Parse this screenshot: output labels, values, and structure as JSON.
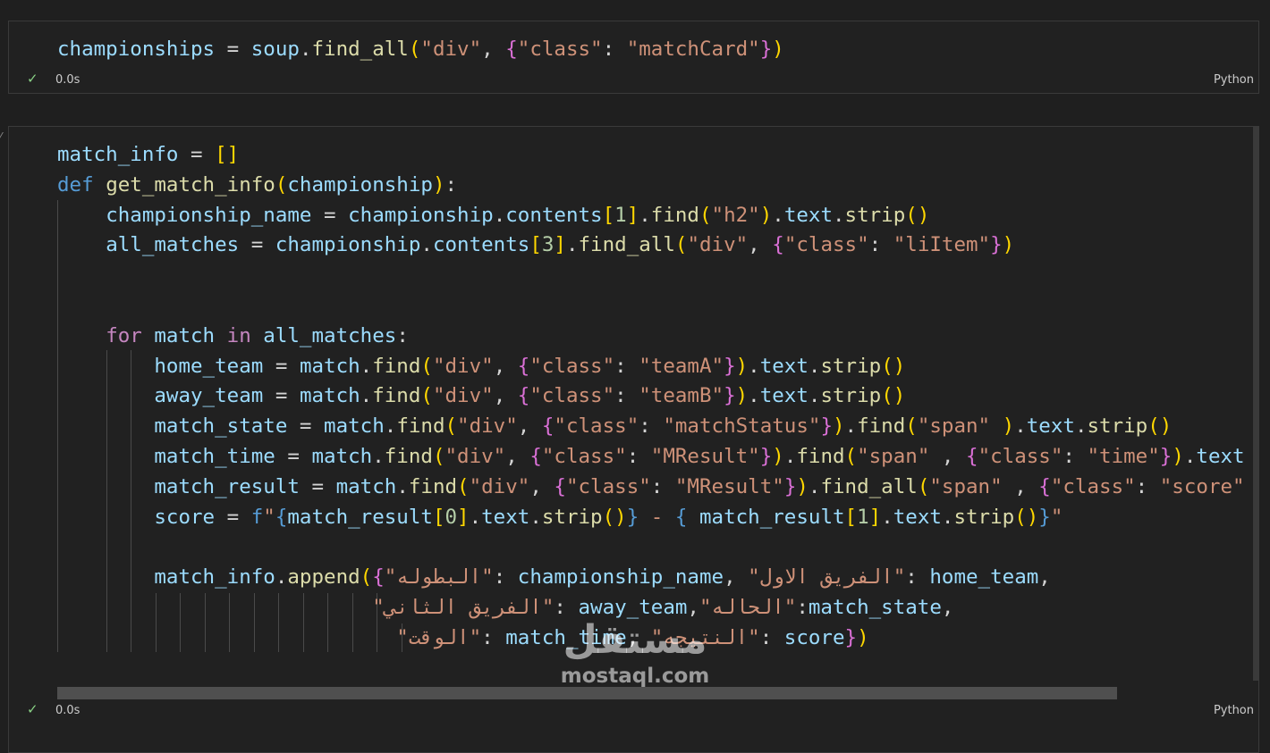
{
  "cell1": {
    "code": [
      [
        [
          "v",
          "championships"
        ],
        [
          "p",
          " = "
        ],
        [
          "v",
          "soup"
        ],
        [
          "p",
          "."
        ],
        [
          "f",
          "find_all"
        ],
        [
          "b1",
          "("
        ],
        [
          "s",
          "\"div\""
        ],
        [
          "p",
          ", "
        ],
        [
          "b2",
          "{"
        ],
        [
          "s",
          "\"class\""
        ],
        [
          "p",
          ": "
        ],
        [
          "s",
          "\"matchCard\""
        ],
        [
          "b2",
          "}"
        ],
        [
          "b1",
          ")"
        ]
      ]
    ],
    "status_check": "✓",
    "exec_time": "0.0s",
    "language": "Python"
  },
  "cell2": {
    "code": [
      [
        [
          "v",
          "match_info"
        ],
        [
          "p",
          " = "
        ],
        [
          "b1",
          "[]"
        ]
      ],
      [
        [
          "k",
          "def "
        ],
        [
          "f",
          "get_match_info"
        ],
        [
          "b1",
          "("
        ],
        [
          "v",
          "championship"
        ],
        [
          "b1",
          ")"
        ],
        [
          "p",
          ":"
        ]
      ],
      [
        [
          "p",
          "    "
        ],
        [
          "v",
          "championship_name"
        ],
        [
          "p",
          " = "
        ],
        [
          "v",
          "championship"
        ],
        [
          "p",
          "."
        ],
        [
          "v",
          "contents"
        ],
        [
          "b1",
          "["
        ],
        [
          "n",
          "1"
        ],
        [
          "b1",
          "]"
        ],
        [
          "p",
          "."
        ],
        [
          "f",
          "find"
        ],
        [
          "b1",
          "("
        ],
        [
          "s",
          "\"h2\""
        ],
        [
          "b1",
          ")"
        ],
        [
          "p",
          "."
        ],
        [
          "v",
          "text"
        ],
        [
          "p",
          "."
        ],
        [
          "f",
          "strip"
        ],
        [
          "b1",
          "()"
        ]
      ],
      [
        [
          "p",
          "    "
        ],
        [
          "v",
          "all_matches"
        ],
        [
          "p",
          " = "
        ],
        [
          "v",
          "championship"
        ],
        [
          "p",
          "."
        ],
        [
          "v",
          "contents"
        ],
        [
          "b1",
          "["
        ],
        [
          "n",
          "3"
        ],
        [
          "b1",
          "]"
        ],
        [
          "p",
          "."
        ],
        [
          "f",
          "find_all"
        ],
        [
          "b1",
          "("
        ],
        [
          "s",
          "\"div\""
        ],
        [
          "p",
          ", "
        ],
        [
          "b2",
          "{"
        ],
        [
          "s",
          "\"class\""
        ],
        [
          "p",
          ": "
        ],
        [
          "s",
          "\"liItem\""
        ],
        [
          "b2",
          "}"
        ],
        [
          "b1",
          ")"
        ]
      ],
      [],
      [],
      [
        [
          "p",
          "    "
        ],
        [
          "c",
          "for "
        ],
        [
          "v",
          "match"
        ],
        [
          "c",
          " in "
        ],
        [
          "v",
          "all_matches"
        ],
        [
          "p",
          ":"
        ]
      ],
      [
        [
          "p",
          "        "
        ],
        [
          "v",
          "home_team"
        ],
        [
          "p",
          " = "
        ],
        [
          "v",
          "match"
        ],
        [
          "p",
          "."
        ],
        [
          "f",
          "find"
        ],
        [
          "b1",
          "("
        ],
        [
          "s",
          "\"div\""
        ],
        [
          "p",
          ", "
        ],
        [
          "b2",
          "{"
        ],
        [
          "s",
          "\"class\""
        ],
        [
          "p",
          ": "
        ],
        [
          "s",
          "\"teamA\""
        ],
        [
          "b2",
          "}"
        ],
        [
          "b1",
          ")"
        ],
        [
          "p",
          "."
        ],
        [
          "v",
          "text"
        ],
        [
          "p",
          "."
        ],
        [
          "f",
          "strip"
        ],
        [
          "b1",
          "()"
        ]
      ],
      [
        [
          "p",
          "        "
        ],
        [
          "v",
          "away_team"
        ],
        [
          "p",
          " = "
        ],
        [
          "v",
          "match"
        ],
        [
          "p",
          "."
        ],
        [
          "f",
          "find"
        ],
        [
          "b1",
          "("
        ],
        [
          "s",
          "\"div\""
        ],
        [
          "p",
          ", "
        ],
        [
          "b2",
          "{"
        ],
        [
          "s",
          "\"class\""
        ],
        [
          "p",
          ": "
        ],
        [
          "s",
          "\"teamB\""
        ],
        [
          "b2",
          "}"
        ],
        [
          "b1",
          ")"
        ],
        [
          "p",
          "."
        ],
        [
          "v",
          "text"
        ],
        [
          "p",
          "."
        ],
        [
          "f",
          "strip"
        ],
        [
          "b1",
          "()"
        ]
      ],
      [
        [
          "p",
          "        "
        ],
        [
          "v",
          "match_state"
        ],
        [
          "p",
          " = "
        ],
        [
          "v",
          "match"
        ],
        [
          "p",
          "."
        ],
        [
          "f",
          "find"
        ],
        [
          "b1",
          "("
        ],
        [
          "s",
          "\"div\""
        ],
        [
          "p",
          ", "
        ],
        [
          "b2",
          "{"
        ],
        [
          "s",
          "\"class\""
        ],
        [
          "p",
          ": "
        ],
        [
          "s",
          "\"matchStatus\""
        ],
        [
          "b2",
          "}"
        ],
        [
          "b1",
          ")"
        ],
        [
          "p",
          "."
        ],
        [
          "f",
          "find"
        ],
        [
          "b1",
          "("
        ],
        [
          "s",
          "\"span\""
        ],
        [
          "p",
          " "
        ],
        [
          "b1",
          ")"
        ],
        [
          "p",
          "."
        ],
        [
          "v",
          "text"
        ],
        [
          "p",
          "."
        ],
        [
          "f",
          "strip"
        ],
        [
          "b1",
          "()"
        ]
      ],
      [
        [
          "p",
          "        "
        ],
        [
          "v",
          "match_time"
        ],
        [
          "p",
          " = "
        ],
        [
          "v",
          "match"
        ],
        [
          "p",
          "."
        ],
        [
          "f",
          "find"
        ],
        [
          "b1",
          "("
        ],
        [
          "s",
          "\"div\""
        ],
        [
          "p",
          ", "
        ],
        [
          "b2",
          "{"
        ],
        [
          "s",
          "\"class\""
        ],
        [
          "p",
          ": "
        ],
        [
          "s",
          "\"MResult\""
        ],
        [
          "b2",
          "}"
        ],
        [
          "b1",
          ")"
        ],
        [
          "p",
          "."
        ],
        [
          "f",
          "find"
        ],
        [
          "b1",
          "("
        ],
        [
          "s",
          "\"span\""
        ],
        [
          "p",
          " , "
        ],
        [
          "b2",
          "{"
        ],
        [
          "s",
          "\"class\""
        ],
        [
          "p",
          ": "
        ],
        [
          "s",
          "\"time\""
        ],
        [
          "b2",
          "}"
        ],
        [
          "b1",
          ")"
        ],
        [
          "p",
          "."
        ],
        [
          "v",
          "text"
        ]
      ],
      [
        [
          "p",
          "        "
        ],
        [
          "v",
          "match_result"
        ],
        [
          "p",
          " = "
        ],
        [
          "v",
          "match"
        ],
        [
          "p",
          "."
        ],
        [
          "f",
          "find"
        ],
        [
          "b1",
          "("
        ],
        [
          "s",
          "\"div\""
        ],
        [
          "p",
          ", "
        ],
        [
          "b2",
          "{"
        ],
        [
          "s",
          "\"class\""
        ],
        [
          "p",
          ": "
        ],
        [
          "s",
          "\"MResult\""
        ],
        [
          "b2",
          "}"
        ],
        [
          "b1",
          ")"
        ],
        [
          "p",
          "."
        ],
        [
          "f",
          "find_all"
        ],
        [
          "b1",
          "("
        ],
        [
          "s",
          "\"span\""
        ],
        [
          "p",
          " , "
        ],
        [
          "b2",
          "{"
        ],
        [
          "s",
          "\"class\""
        ],
        [
          "p",
          ": "
        ],
        [
          "s",
          "\"score\""
        ]
      ],
      [
        [
          "p",
          "        "
        ],
        [
          "v",
          "score"
        ],
        [
          "p",
          " = "
        ],
        [
          "k",
          "f"
        ],
        [
          "s",
          "\""
        ],
        [
          "k",
          "{"
        ],
        [
          "v",
          "match_result"
        ],
        [
          "b1",
          "["
        ],
        [
          "n",
          "0"
        ],
        [
          "b1",
          "]"
        ],
        [
          "p",
          "."
        ],
        [
          "v",
          "text"
        ],
        [
          "p",
          "."
        ],
        [
          "f",
          "strip"
        ],
        [
          "b1",
          "()"
        ],
        [
          "k",
          "}"
        ],
        [
          "s",
          " - "
        ],
        [
          "k",
          "{"
        ],
        [
          "p",
          " "
        ],
        [
          "v",
          "match_result"
        ],
        [
          "b1",
          "["
        ],
        [
          "n",
          "1"
        ],
        [
          "b1",
          "]"
        ],
        [
          "p",
          "."
        ],
        [
          "v",
          "text"
        ],
        [
          "p",
          "."
        ],
        [
          "f",
          "strip"
        ],
        [
          "b1",
          "()"
        ],
        [
          "k",
          "}"
        ],
        [
          "s",
          "\""
        ]
      ],
      [],
      [
        [
          "p",
          "        "
        ],
        [
          "v",
          "match_info"
        ],
        [
          "p",
          "."
        ],
        [
          "f",
          "append"
        ],
        [
          "b1",
          "("
        ],
        [
          "b2",
          "{"
        ],
        [
          "s",
          "\"البطوله\""
        ],
        [
          "p",
          ": "
        ],
        [
          "v",
          "championship_name"
        ],
        [
          "p",
          ", "
        ],
        [
          "s",
          "\"الفريق الاول\""
        ],
        [
          "p",
          ": "
        ],
        [
          "v",
          "home_team"
        ],
        [
          "p",
          ","
        ]
      ],
      [
        [
          "p",
          "                          "
        ],
        [
          "s",
          "\"الفريق الثاني\""
        ],
        [
          "p",
          ": "
        ],
        [
          "v",
          "away_team"
        ],
        [
          "p",
          ","
        ],
        [
          "s",
          "\"الحاله\""
        ],
        [
          "p",
          ":"
        ],
        [
          "v",
          "match_state"
        ],
        [
          "p",
          ","
        ]
      ],
      [
        [
          "p",
          "                            "
        ],
        [
          "s",
          "\"الوقت\""
        ],
        [
          "p",
          ": "
        ],
        [
          "v",
          "match_time"
        ],
        [
          "p",
          ", "
        ],
        [
          "s",
          "\"النتيجه\""
        ],
        [
          "p",
          ": "
        ],
        [
          "v",
          "score"
        ],
        [
          "b2",
          "}"
        ],
        [
          "b1",
          ")"
        ]
      ]
    ],
    "status_check": "✓",
    "exec_time": "0.0s",
    "language": "Python"
  },
  "watermark": {
    "logo_text": "مستقل",
    "site": "mostaql.com"
  },
  "colors": {
    "background": "#1f1f1f",
    "cell_background": "#212121",
    "check": "#89d185",
    "variable": "#9cdcfe",
    "function": "#dcdcaa",
    "string": "#ce9178",
    "keyword": "#569cd6",
    "control": "#c586c0",
    "number": "#b5cea8",
    "bracket_level1": "#ffd700",
    "bracket_level2": "#da70d6"
  }
}
